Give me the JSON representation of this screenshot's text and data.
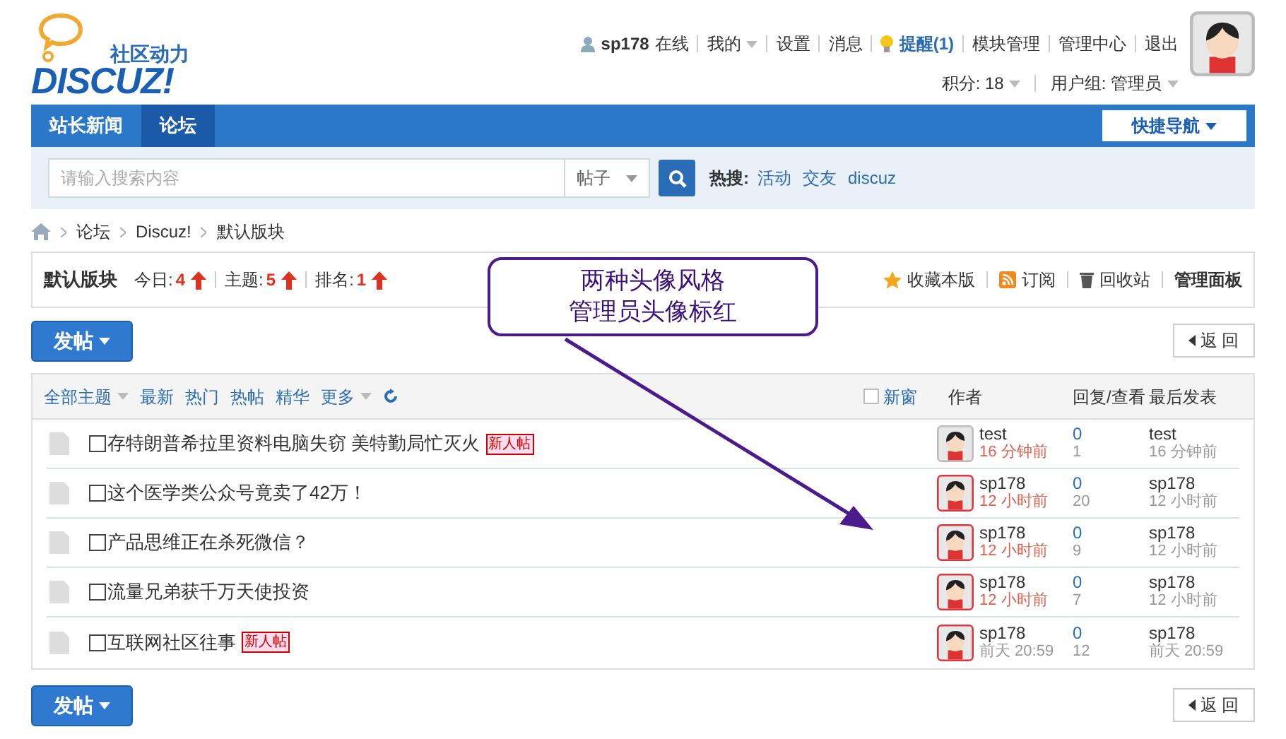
{
  "logo": {
    "tagline": "社区动力",
    "wordmark": "DISCUZ!"
  },
  "user_bar": {
    "username": "sp178",
    "status": "在线",
    "links": [
      {
        "label": "我的",
        "dropdown": true
      },
      {
        "label": "设置",
        "dropdown": false
      },
      {
        "label": "消息",
        "dropdown": false
      },
      {
        "label": "提醒(1)",
        "dropdown": false,
        "kind": "alert"
      },
      {
        "label": "模块管理",
        "dropdown": false
      },
      {
        "label": "管理中心",
        "dropdown": false
      },
      {
        "label": "退出",
        "dropdown": false
      }
    ],
    "points": "积分: 18",
    "group": "用户组: 管理员"
  },
  "nav": {
    "items": [
      {
        "label": "站长新闻",
        "selected": false
      },
      {
        "label": "论坛",
        "selected": true
      }
    ],
    "quick_nav": "快捷导航"
  },
  "search": {
    "placeholder": "请输入搜索内容",
    "scope": "帖子",
    "hot_label": "热搜:",
    "hot": [
      "活动",
      "交友",
      "discuz"
    ]
  },
  "breadcrumb": [
    "论坛",
    "Discuz!",
    "默认版块"
  ],
  "forum": {
    "name": "默认版块",
    "stats": [
      {
        "label": "今日:",
        "value": "4"
      },
      {
        "label": "主题:",
        "value": "5"
      },
      {
        "label": "排名:",
        "value": "1"
      }
    ],
    "actions": [
      {
        "label": "收藏本版",
        "kind": "star"
      },
      {
        "label": "订阅",
        "kind": "rss"
      },
      {
        "label": "回收站",
        "kind": "trash"
      },
      {
        "label": "管理面板",
        "kind": "bold"
      }
    ]
  },
  "top_bar": {
    "post_button": "发帖",
    "back_button": "返 回"
  },
  "bottom_bar": {
    "post_button": "发帖",
    "back_button": "返 回"
  },
  "filters": [
    {
      "label": "全部主题",
      "dropdown": true
    },
    {
      "label": "最新",
      "dropdown": false
    },
    {
      "label": "热门",
      "dropdown": false
    },
    {
      "label": "热帖",
      "dropdown": false
    },
    {
      "label": "精华",
      "dropdown": false
    },
    {
      "label": "更多",
      "dropdown": true
    }
  ],
  "new_window": {
    "label": "新窗",
    "checked": false
  },
  "columns": [
    "作者",
    "回复/查看",
    "最后发表"
  ],
  "threads": [
    {
      "title": "存特朗普希拉里资料电脑失窃 美特勤局忙灭火",
      "badge": "新人帖",
      "author": "test",
      "admin": false,
      "time": "16 分钟前",
      "recent": true,
      "replies": "0",
      "views": "1",
      "last_user": "test",
      "last_time": "16 分钟前"
    },
    {
      "title": "这个医学类公众号竟卖了42万！",
      "author": "sp178",
      "admin": true,
      "time": "12 小时前",
      "recent": true,
      "replies": "0",
      "views": "20",
      "last_user": "sp178",
      "last_time": "12 小时前"
    },
    {
      "title": "产品思维正在杀死微信？",
      "author": "sp178",
      "admin": true,
      "time": "12 小时前",
      "recent": true,
      "replies": "0",
      "views": "9",
      "last_user": "sp178",
      "last_time": "12 小时前"
    },
    {
      "title": "流量兄弟获千万天使投资",
      "author": "sp178",
      "admin": true,
      "time": "12 小时前",
      "recent": true,
      "replies": "0",
      "views": "7",
      "last_user": "sp178",
      "last_time": "12 小时前"
    },
    {
      "title": "互联网社区往事",
      "badge": "新人帖",
      "author": "sp178",
      "admin": true,
      "time": "前天 20:59",
      "recent": false,
      "replies": "0",
      "views": "12",
      "last_user": "sp178",
      "last_time": "前天 20:59"
    }
  ],
  "callout": {
    "lines": [
      "两种头像风格",
      "管理员头像标红"
    ]
  }
}
